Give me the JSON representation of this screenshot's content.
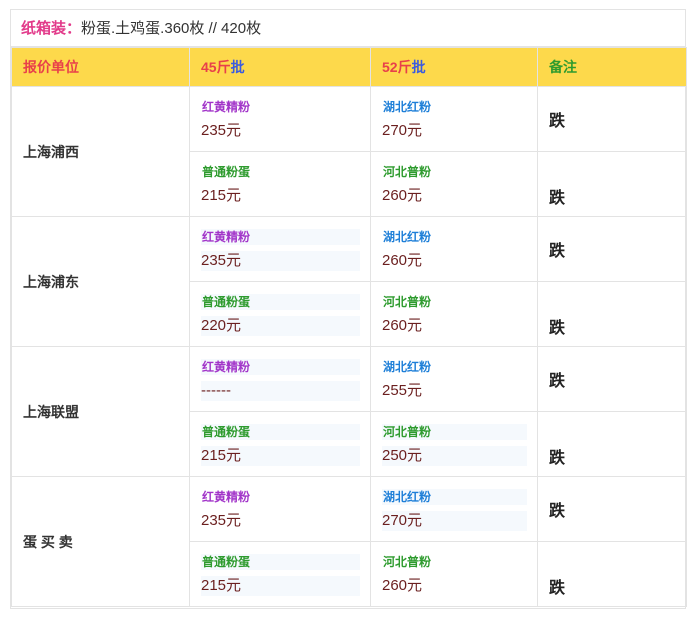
{
  "title": {
    "prefix": "纸箱装：",
    "rest": "粉蛋.土鸡蛋.360枚 // 420枚"
  },
  "header": {
    "unit": "报价单位",
    "price45_a": "45斤",
    "price45_b": "批",
    "price52_a": "52斤",
    "price52_b": "批",
    "note": "备注"
  },
  "regions": [
    {
      "name": "上海浦西",
      "rows": [
        {
          "a_label": "红黄精粉",
          "a_value": "235元",
          "b_label": "湖北红粉",
          "b_value": "270元",
          "note": "跌"
        },
        {
          "a_label": "普通粉蛋",
          "a_value": "215元",
          "b_label": "河北普粉",
          "b_value": "260元",
          "note": "跌"
        }
      ]
    },
    {
      "name": "上海浦东",
      "rows": [
        {
          "a_label": "红黄精粉",
          "a_value": "235元",
          "b_label": "湖北红粉",
          "b_value": "260元",
          "note": "跌"
        },
        {
          "a_label": "普通粉蛋",
          "a_value": "220元",
          "b_label": "河北普粉",
          "b_value": "260元",
          "note": "跌"
        }
      ]
    },
    {
      "name": "上海联盟",
      "rows": [
        {
          "a_label": "红黄精粉",
          "a_value": "------",
          "b_label": "湖北红粉",
          "b_value": "255元",
          "note": "跌"
        },
        {
          "a_label": "普通粉蛋",
          "a_value": "215元",
          "b_label": "河北普粉",
          "b_value": "250元",
          "note": "跌"
        }
      ]
    },
    {
      "name": "蛋 买 卖",
      "rows": [
        {
          "a_label": "红黄精粉",
          "a_value": "235元",
          "b_label": "湖北红粉",
          "b_value": "270元",
          "note": "跌"
        },
        {
          "a_label": "普通粉蛋",
          "a_value": "215元",
          "b_label": "河北普粉",
          "b_value": "260元",
          "note": "跌"
        }
      ]
    }
  ]
}
